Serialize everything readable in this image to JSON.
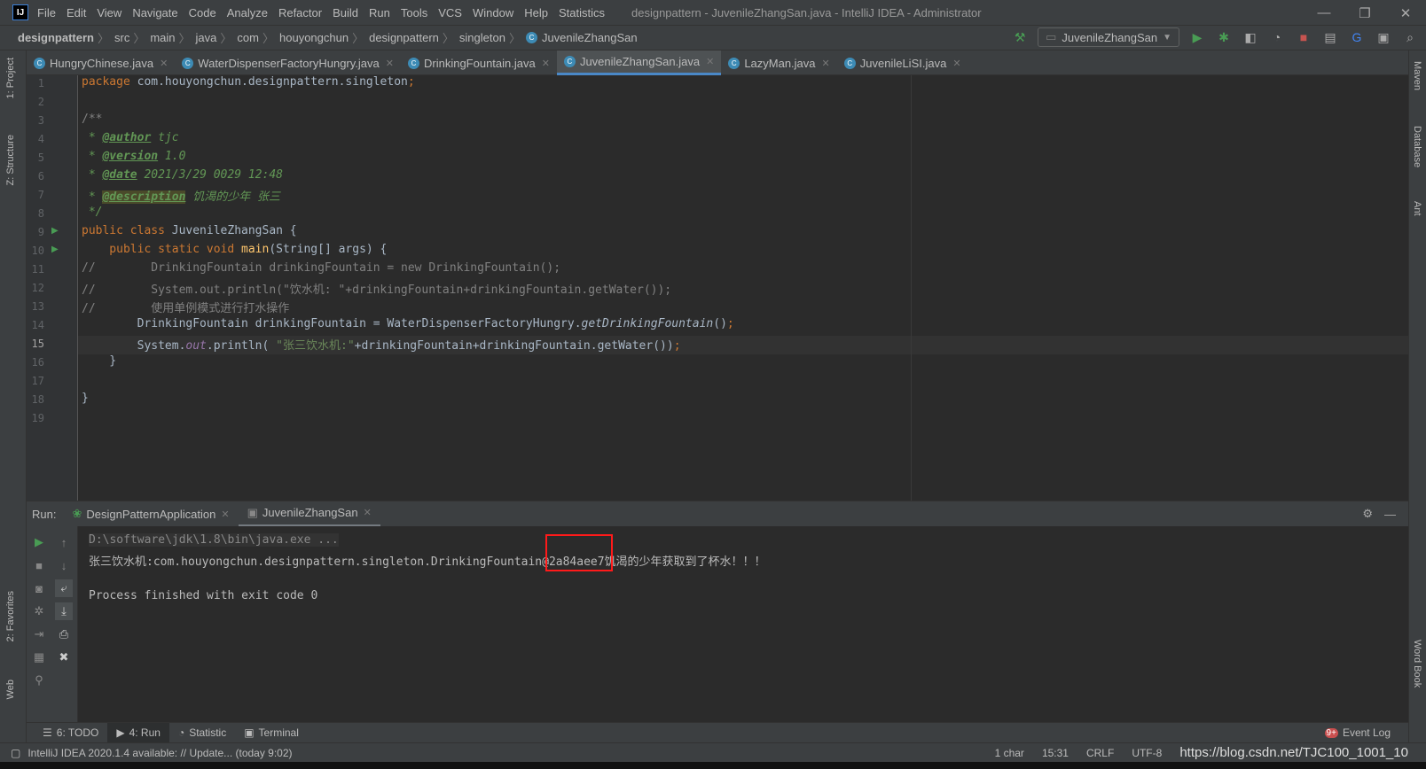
{
  "titlebar": {
    "logo": "IJ",
    "menu": [
      "File",
      "Edit",
      "View",
      "Navigate",
      "Code",
      "Analyze",
      "Refactor",
      "Build",
      "Run",
      "Tools",
      "VCS",
      "Window",
      "Help",
      "Statistics"
    ],
    "title": "designpattern - JuvenileZhangSan.java - IntelliJ IDEA - Administrator",
    "controls": [
      "—",
      "❐",
      "✕"
    ]
  },
  "breadcrumb": [
    "designpattern",
    "src",
    "main",
    "java",
    "com",
    "houyongchun",
    "designpattern",
    "singleton",
    "JuvenileZhangSan"
  ],
  "toolbar": {
    "run_config": "JuvenileZhangSan"
  },
  "tabs": [
    {
      "label": "HungryChinese.java"
    },
    {
      "label": "WaterDispenserFactoryHungry.java"
    },
    {
      "label": "DrinkingFountain.java"
    },
    {
      "label": "JuvenileZhangSan.java",
      "active": true
    },
    {
      "label": "LazyMan.java"
    },
    {
      "label": "JuvenileLiSI.java"
    }
  ],
  "left_tool_windows": [
    "1: Project",
    "Z: Structure",
    "2: Favorites",
    "Web"
  ],
  "right_tool_windows": [
    "Maven",
    "Database",
    "Ant",
    "Word Book"
  ],
  "editor": {
    "current_line": 15,
    "lines": [
      "1",
      "2",
      "3",
      "4",
      "5",
      "6",
      "7",
      "8",
      "9",
      "10",
      "11",
      "12",
      "13",
      "14",
      "15",
      "16",
      "17",
      "18",
      "19"
    ],
    "code": {
      "l1a": "package",
      "l1b": " com.houyongchun.designpattern.singleton",
      "l1c": ";",
      "l3": "/**",
      "l4a": " * ",
      "l4b": "@author",
      "l4c": " tjc",
      "l5a": " * ",
      "l5b": "@version",
      "l5c": " 1.0",
      "l6a": " * ",
      "l6b": "@date",
      "l6c": " 2021/3/29 0029 12:48",
      "l7a": " * ",
      "l7b": "@description",
      "l7c": " 饥渴的少年 张三",
      "l8": " */",
      "l9a": "public class",
      "l9b": " JuvenileZhangSan {",
      "l10a": "    public static void",
      "l10b": " main",
      "l10c": "(String[] args) {",
      "l11": "//        DrinkingFountain drinkingFountain = new DrinkingFountain();",
      "l12": "//        System.out.println(\"饮水机: \"+drinkingFountain+drinkingFountain.getWater());",
      "l13": "//        使用单例模式进行打水操作",
      "l14a": "        DrinkingFountain drinkingFountain = WaterDispenserFactoryHungry.",
      "l14b": "getDrinkingFountain",
      "l14c": "()",
      "l14d": ";",
      "l15a": "        System.",
      "l15b": "out",
      "l15c": ".println( ",
      "l15d": "\"张三饮水机:\"",
      "l15e": "+drinkingFountain+drinkingFountain.getWater())",
      "l15f": ";",
      "l16": "    }",
      "l18": "}"
    }
  },
  "run": {
    "label": "Run:",
    "tabs": [
      {
        "label": "DesignPatternApplication"
      },
      {
        "label": "JuvenileZhangSan",
        "active": true
      }
    ],
    "output": [
      "D:\\software\\jdk\\1.8\\bin\\java.exe ...",
      "张三饮水机:com.houyongchun.designpattern.singleton.DrinkingFountain@2a84aee7饥渴的少年获取到了杯水！！！",
      "",
      "Process finished with exit code 0"
    ],
    "highlight_color": "#ff1a1a"
  },
  "bottom_tabs": [
    {
      "label": "6: TODO"
    },
    {
      "label": "4: Run",
      "active": true
    },
    {
      "label": "Statistic"
    },
    {
      "label": "Terminal"
    }
  ],
  "event_log": {
    "badge": "9+",
    "label": "Event Log"
  },
  "status": {
    "message": "IntelliJ IDEA 2020.1.4 available: // Update... (today 9:02)",
    "selection": "1 char",
    "position": "15:31",
    "line_sep": "CRLF",
    "encoding": "UTF-8",
    "watermark": "https://blog.csdn.net/TJC100_1001_10"
  }
}
